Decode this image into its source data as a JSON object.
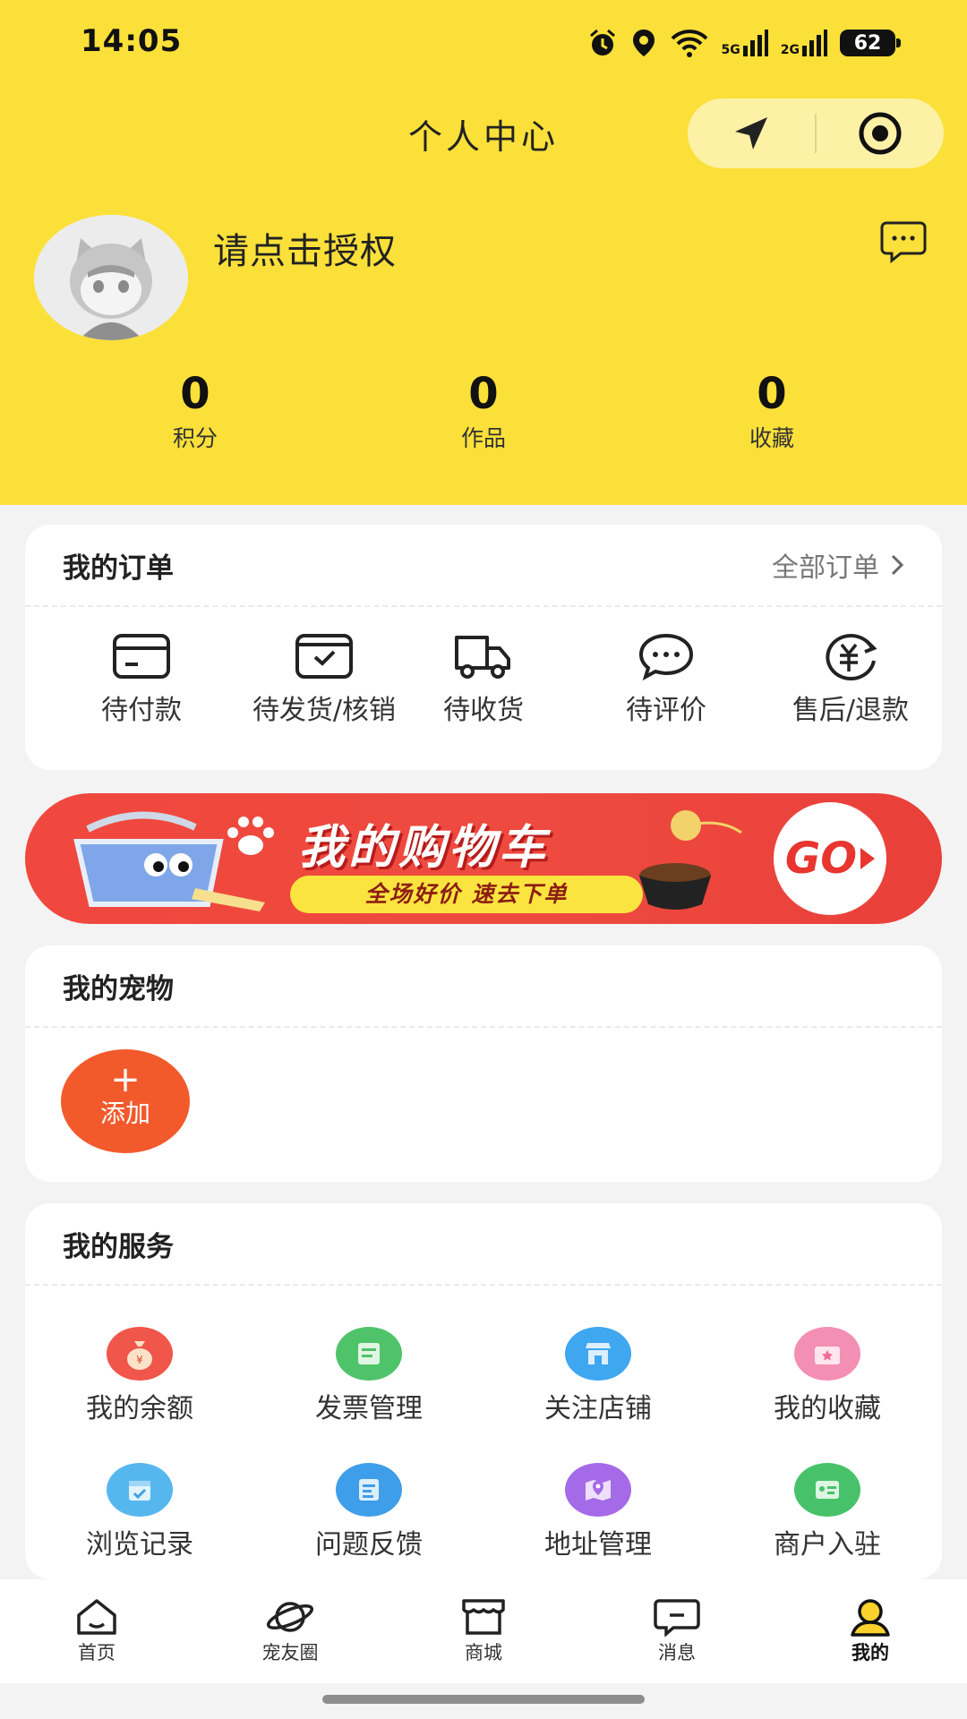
{
  "status_bar": {
    "time": "14:05",
    "net1": "5G",
    "net2": "2G",
    "battery": "62"
  },
  "header": {
    "title": "个人中心"
  },
  "profile": {
    "auth_text": "请点击授权"
  },
  "stats": [
    {
      "value": "0",
      "label": "积分"
    },
    {
      "value": "0",
      "label": "作品"
    },
    {
      "value": "0",
      "label": "收藏"
    }
  ],
  "orders": {
    "title": "我的订单",
    "all_label": "全部订单",
    "items": [
      {
        "label": "待付款",
        "icon": "card-icon"
      },
      {
        "label": "待发货/核销",
        "icon": "box-check-icon"
      },
      {
        "label": "待收货",
        "icon": "truck-icon"
      },
      {
        "label": "待评价",
        "icon": "chat-icon"
      },
      {
        "label": "售后/退款",
        "icon": "yen-refund-icon"
      }
    ]
  },
  "banner": {
    "title": "我的购物车",
    "subtitle": "全场好价 速去下单",
    "go": "GO"
  },
  "pets": {
    "title": "我的宠物",
    "add_plus": "+",
    "add_label": "添加"
  },
  "services": {
    "title": "我的服务",
    "items": [
      {
        "label": "我的余额",
        "icon": "money-bag-icon",
        "color": "#f0564a"
      },
      {
        "label": "发票管理",
        "icon": "invoice-icon",
        "color": "#4fc36a"
      },
      {
        "label": "关注店铺",
        "icon": "store-icon",
        "color": "#3fa6f0"
      },
      {
        "label": "我的收藏",
        "icon": "favorite-envelope-icon",
        "color": "#f38fb3"
      },
      {
        "label": "浏览记录",
        "icon": "calendar-icon",
        "color": "#56b7ef"
      },
      {
        "label": "问题反馈",
        "icon": "feedback-icon",
        "color": "#3f9eea"
      },
      {
        "label": "地址管理",
        "icon": "map-pin-icon",
        "color": "#a56ae8"
      },
      {
        "label": "商户入驻",
        "icon": "merchant-icon",
        "color": "#47c26a"
      }
    ]
  },
  "tabbar": [
    {
      "label": "首页",
      "icon": "home-icon"
    },
    {
      "label": "宠友圈",
      "icon": "planet-icon"
    },
    {
      "label": "商城",
      "icon": "shop-icon"
    },
    {
      "label": "消息",
      "icon": "message-icon"
    },
    {
      "label": "我的",
      "icon": "user-icon",
      "active": true
    }
  ],
  "colors": {
    "header": "#fbe03a",
    "accent_orange": "#f25a2c",
    "banner_red": "#ee4a3f"
  }
}
